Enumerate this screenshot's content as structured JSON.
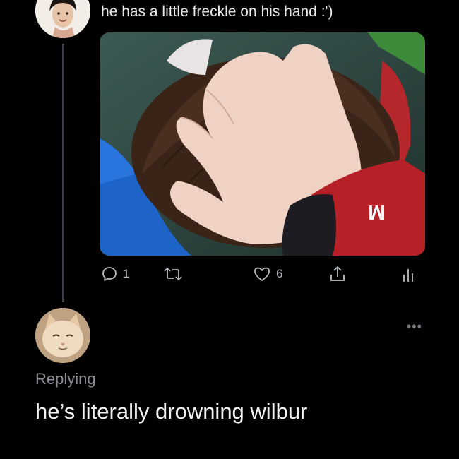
{
  "tweet": {
    "text": "he has a little freckle on his hand :')",
    "media": {
      "alt": "",
      "colors": {
        "water": "#2f4a44",
        "hair": "#3a2418",
        "skin": "#e8c7b4",
        "kayak": "#1e63c8",
        "sleeve": "#c1272d"
      }
    },
    "actions": {
      "reply": {
        "icon": "reply-icon",
        "count": "1"
      },
      "retweet": {
        "icon": "retweet-icon",
        "count": ""
      },
      "like": {
        "icon": "heart-icon",
        "count": "6"
      },
      "share": {
        "icon": "share-icon"
      },
      "stats": {
        "icon": "analytics-icon"
      }
    }
  },
  "reply": {
    "more_label": "•••",
    "replying_label": "Replying",
    "text": "he’s literally drowning wilbur"
  },
  "colors": {
    "background": "#000000",
    "text": "#e7e9ea",
    "muted": "#8a8f95",
    "thread_line": "#3d4146"
  }
}
